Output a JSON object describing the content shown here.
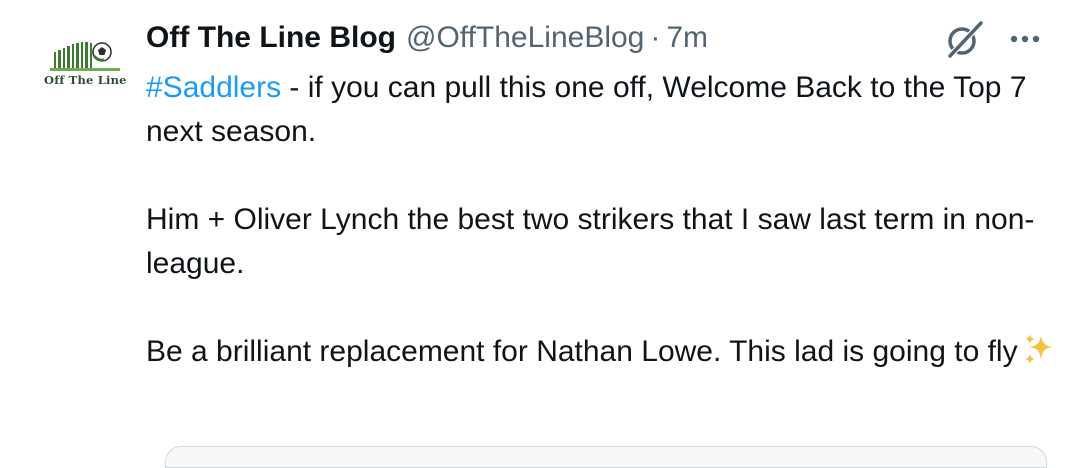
{
  "tweet": {
    "avatar_text": "Off The Line",
    "display_name": "Off The Line Blog",
    "handle": "@OffTheLineBlog",
    "separator": "·",
    "timestamp": "7m",
    "hashtag": "#Saddlers",
    "line1_rest": " - if you can pull this one off, Welcome Back to the Top 7 next season.",
    "para2": "Him + Oliver Lynch the best two strikers that I saw last term in non-league.",
    "para3": "Be a brilliant replacement for Nathan Lowe. This lad is going to fly",
    "emoji_name": "sparkles-icon"
  },
  "icons": {
    "grok": "grok-icon",
    "more": "more-options-icon"
  },
  "colors": {
    "text": "#0f1419",
    "secondary": "#536471",
    "link": "#1d9bf0",
    "avatar_green": "#4a8a3a",
    "sparkle": "#f5c242"
  }
}
